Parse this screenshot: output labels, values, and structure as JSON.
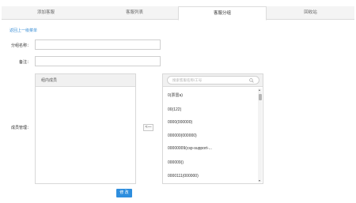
{
  "tabs": [
    {
      "label": "添加客服"
    },
    {
      "label": "客服列表"
    },
    {
      "label": "客服分组"
    },
    {
      "label": "回收站"
    }
  ],
  "active_tab": "客服分组",
  "back_link": "返回上一级菜单",
  "form": {
    "group_name_label": "分组名称：",
    "group_name_value": "",
    "remark_label": "备注：",
    "remark_value": "",
    "members_label": "成员管理："
  },
  "left_panel": {
    "title": "组内成员"
  },
  "right_panel": {
    "search_placeholder": "搜索客服名称/工号",
    "items": [
      "0(票雷a)",
      "00(122)",
      "0000(000000)",
      "000000(000000)",
      "00000009(csp-support-...",
      "000009()",
      "0000111(000000)"
    ]
  },
  "move_button": "<—",
  "submit_button": "修 改",
  "colors": {
    "accent": "#2e8ede",
    "link": "#3b8fd6",
    "tab_bg": "#f4f4f4",
    "panel_header": "#f1f1f1"
  }
}
